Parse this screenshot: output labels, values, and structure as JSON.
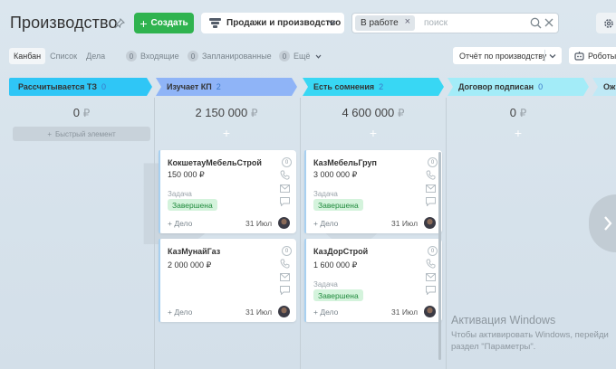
{
  "header": {
    "title": "Производство",
    "create_label": "Создать",
    "pipeline_label": "Продажи и производство",
    "filter_tag": "В работе",
    "search_placeholder": "поиск"
  },
  "views": [
    {
      "label": "Канбан",
      "active": true
    },
    {
      "label": "Список",
      "active": false
    },
    {
      "label": "Дела",
      "active": false
    }
  ],
  "counters": [
    {
      "num": "0",
      "label": "Входящие"
    },
    {
      "num": "0",
      "label": "Запланированные"
    },
    {
      "num": "0",
      "label": "Ещё"
    }
  ],
  "toolbar": {
    "report_label": "Отчёт по производству",
    "robots_label": "Роботы"
  },
  "stages": [
    {
      "name": "Рассчитывается ТЗ",
      "count": "0",
      "sum": "0",
      "color": "#2fc6f6"
    },
    {
      "name": "Изучает КП",
      "count": "2",
      "sum": "2 150 000",
      "color": "#8fb4f7"
    },
    {
      "name": "Есть сомнения",
      "count": "2",
      "sum": "4 600 000",
      "color": "#38d7f4"
    },
    {
      "name": "Договор подписан",
      "count": "0",
      "sum": "0",
      "color": "#a3ecf8"
    },
    {
      "name": "Ож",
      "count": "",
      "sum": "",
      "color": "#bfe9f6"
    }
  ],
  "currency": "₽",
  "quick_add_label": "Быстрый элемент",
  "cards": [
    {
      "title": "КокшетауМебельСтрой",
      "sum": "150 000 ₽",
      "task_label": "Задача",
      "status": "Завершена",
      "deal": "+ Дело",
      "date": "31 Июл",
      "num": "0"
    },
    {
      "title": "КазМунайГаз",
      "sum": "2 000 000 ₽",
      "deal": "+ Дело",
      "date": "31 Июл",
      "num": "0"
    },
    {
      "title": "КазМебельГруп",
      "sum": "3 000 000 ₽",
      "task_label": "Задача",
      "status": "Завершена",
      "deal": "+ Дело",
      "date": "31 Июл",
      "num": "0"
    },
    {
      "title": "КазДорСтрой",
      "sum": "1 600 000 ₽",
      "task_label": "Задача",
      "status": "Завершена",
      "deal": "+ Дело",
      "date": "31 Июл",
      "num": "0"
    }
  ],
  "windows_activation": {
    "title": "Активация Windows",
    "line1": "Чтобы активировать Windows, перейди",
    "line2": "раздел \"Параметры\"."
  }
}
